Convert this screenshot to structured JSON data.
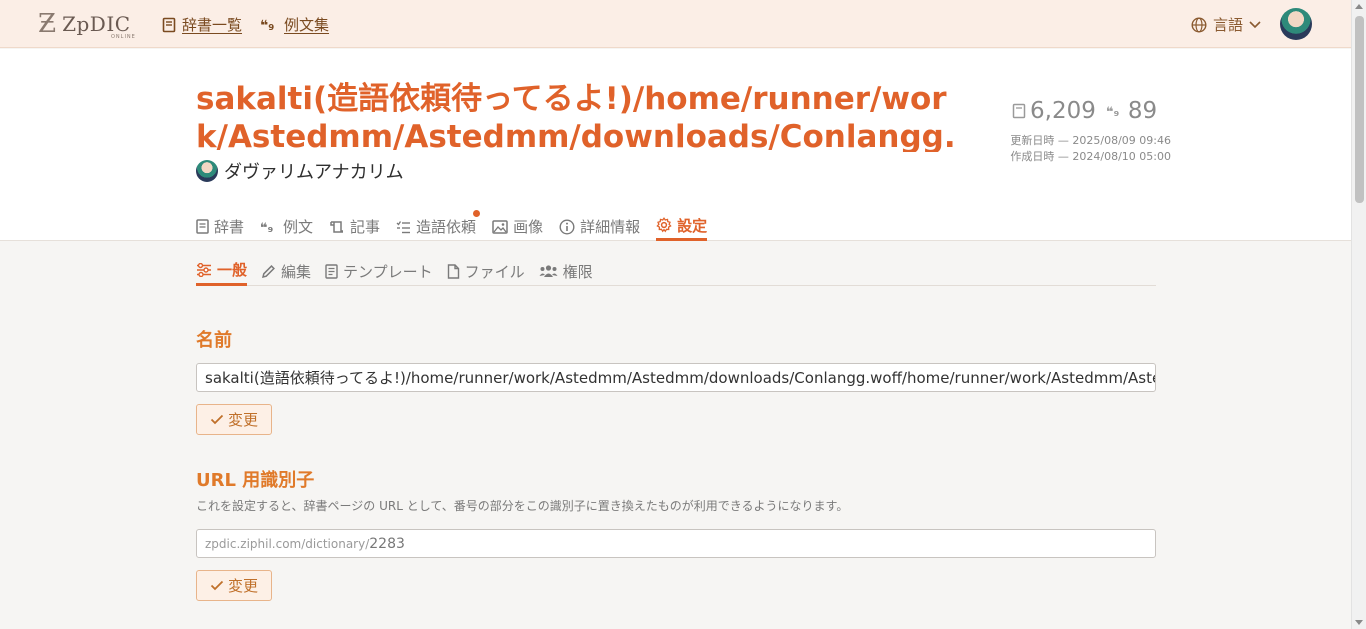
{
  "header": {
    "logo_text": "ZpDIC",
    "logo_sub": "ONLINE",
    "nav": [
      {
        "label": "辞書一覧"
      },
      {
        "label": "例文集"
      }
    ],
    "language_label": "言語"
  },
  "dictionary": {
    "title": "sakalti(造語依頼待ってるよ!)/home/runner/work/Astedmm/Astedmm/downloads/Conlangg.woff/home/runner/work/Astedmm/Astedmm",
    "owner": "ダヴァリムアナカリム",
    "word_count": "6,209",
    "example_count": "89",
    "updated": "更新日時 — 2025/08/09 09:46",
    "created": "作成日時 — 2024/08/10 05:00"
  },
  "tabs": [
    {
      "label": "辞書"
    },
    {
      "label": "例文"
    },
    {
      "label": "記事"
    },
    {
      "label": "造語依頼"
    },
    {
      "label": "画像"
    },
    {
      "label": "詳細情報"
    },
    {
      "label": "設定"
    }
  ],
  "subtabs": [
    {
      "label": "一般"
    },
    {
      "label": "編集"
    },
    {
      "label": "テンプレート"
    },
    {
      "label": "ファイル"
    },
    {
      "label": "権限"
    }
  ],
  "settings": {
    "name_title": "名前",
    "name_value": "sakalti(造語依頼待ってるよ!)/home/runner/work/Astedmm/Astedmm/downloads/Conlangg.woff/home/runner/work/Astedmm/Astedmm",
    "change_label": "変更",
    "url_title": "URL 用識別子",
    "url_desc": "これを設定すると、辞書ページの URL として、番号の部分をこの識別子に置き換えたものが利用できるようになります。",
    "url_prefix": "zpdic.ziphil.com/dictionary/",
    "url_value": "2283"
  },
  "colors": {
    "accent": "#e0622a",
    "header_bg": "#fbeee6"
  }
}
